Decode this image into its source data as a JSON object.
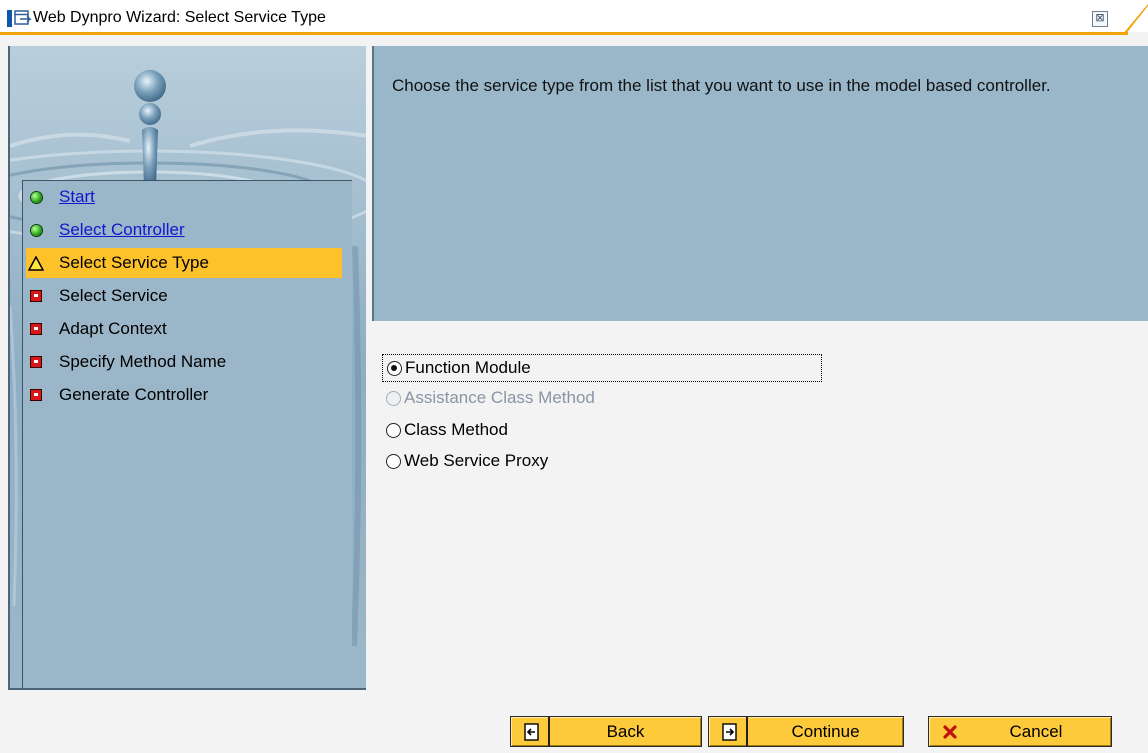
{
  "window": {
    "title": "Web Dynpro Wizard: Select Service Type",
    "close_symbol": "⊠",
    "title_icon": "window-icon",
    "accent_color": "#f0a40a"
  },
  "steps": [
    {
      "label": "Start",
      "status": "done",
      "link": true
    },
    {
      "label": "Select Controller",
      "status": "done",
      "link": true
    },
    {
      "label": "Select Service Type",
      "status": "current",
      "link": false
    },
    {
      "label": "Select Service",
      "status": "pending",
      "link": false
    },
    {
      "label": "Adapt Context",
      "status": "pending",
      "link": false
    },
    {
      "label": "Specify Method Name",
      "status": "pending",
      "link": false
    },
    {
      "label": "Generate Controller",
      "status": "pending",
      "link": false
    }
  ],
  "info": {
    "text": "Choose the service type from the list that you want to use in the model based controller."
  },
  "options": [
    {
      "label": "Function Module",
      "selected": true,
      "enabled": true
    },
    {
      "label": "Assistance Class Method",
      "selected": false,
      "enabled": false
    },
    {
      "label": "Class Method",
      "selected": false,
      "enabled": true
    },
    {
      "label": "Web Service Proxy",
      "selected": false,
      "enabled": true
    }
  ],
  "buttons": {
    "back": "Back",
    "continue": "Continue",
    "cancel": "Cancel"
  }
}
